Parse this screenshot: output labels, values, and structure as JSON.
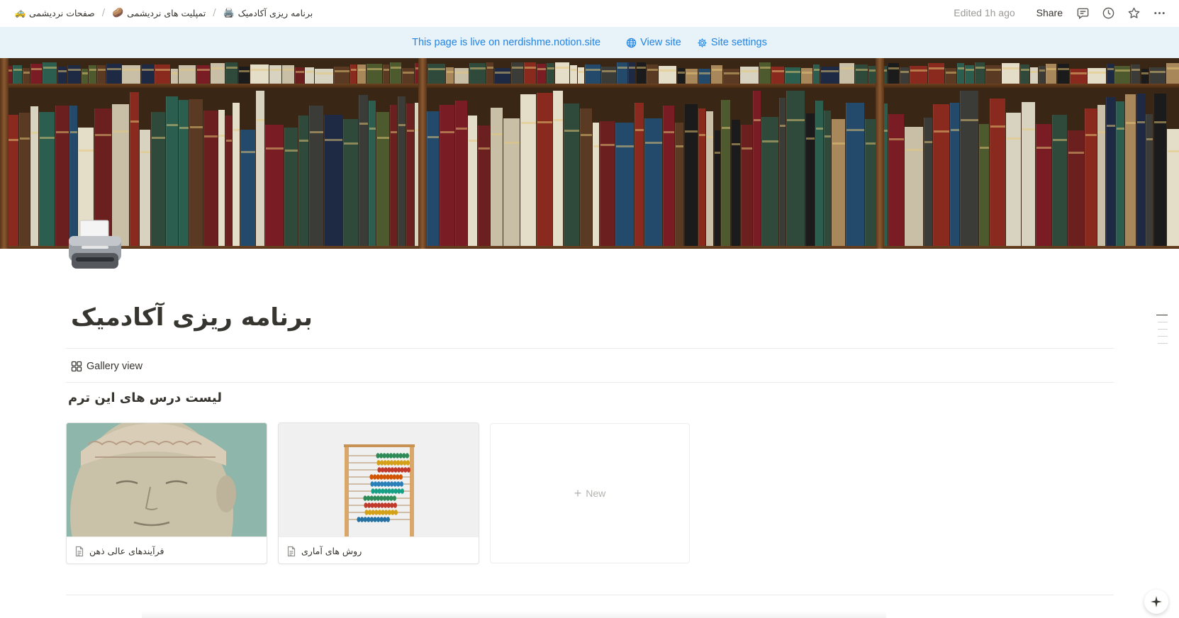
{
  "breadcrumb": [
    {
      "emoji": "🚕",
      "label": "صفحات نردیشمی"
    },
    {
      "emoji": "🥔",
      "label": "تمپلیت های نردیشمی"
    },
    {
      "emoji": "🖨️",
      "label": "برنامه ریزی آکادمیک"
    }
  ],
  "breadcrumb_separator": "/",
  "topbar": {
    "edited": "Edited 1h ago",
    "share": "Share",
    "icons": [
      "comment-icon",
      "history-icon",
      "star-icon",
      "more-icon"
    ]
  },
  "banner": {
    "live_text": "This page is live on nerdishme.notion.site",
    "view_site": "View site",
    "site_settings": "Site settings",
    "color": "#2383e2",
    "background": "#e7f3f8"
  },
  "page": {
    "icon": "printer-icon",
    "title": "برنامه ریزی آکادمیک"
  },
  "database": {
    "view_label": "Gallery view",
    "title": "لیست درس های این ترم",
    "cards": [
      {
        "title": "فرآیندهای عالی ذهن",
        "cover": "brain-bust-cover"
      },
      {
        "title": "روش های آماری",
        "cover": "abacus-cover"
      }
    ],
    "new_label": "New"
  }
}
